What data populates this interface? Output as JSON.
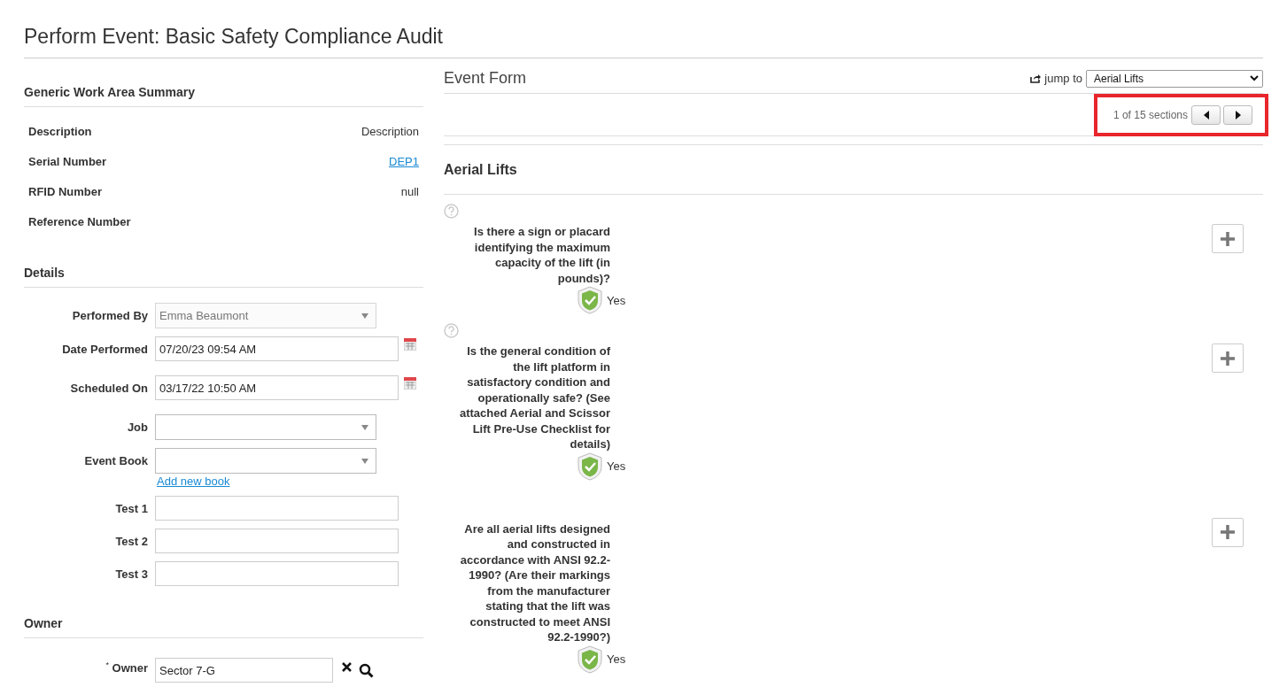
{
  "page_title": "Perform Event: Basic Safety Compliance Audit",
  "summary": {
    "title": "Generic Work Area Summary",
    "rows": [
      {
        "label": "Description",
        "value": "Description"
      },
      {
        "label": "Serial Number",
        "link": "DEP1"
      },
      {
        "label": "RFID Number",
        "value": "null"
      },
      {
        "label": "Reference Number"
      }
    ]
  },
  "details": {
    "title": "Details",
    "fields": [
      {
        "label": "Performed By",
        "kind": "select",
        "value": "Emma Beaumont",
        "disabled": true
      },
      {
        "label": "Date Performed",
        "kind": "date",
        "value": "07/20/23 09:54 AM",
        "disabled": false
      },
      {
        "label": "Scheduled On",
        "kind": "date",
        "value": "03/17/22 10:50 AM",
        "disabled": false
      },
      {
        "label": "Job",
        "kind": "select",
        "disabled": false
      },
      {
        "label": "Event Book",
        "kind": "select",
        "disabled": false,
        "link": "Add new book"
      },
      {
        "label": "Test 1",
        "kind": "text",
        "disabled": false
      },
      {
        "label": "Test 2",
        "kind": "text",
        "disabled": false
      },
      {
        "label": "Test 3",
        "kind": "text",
        "disabled": false
      }
    ]
  },
  "owner": {
    "title": "Owner",
    "required_mark": "*",
    "label": "Owner",
    "value": "Sector 7-G"
  },
  "event_form": {
    "title": "Event Form",
    "jump_label": "jump to",
    "jump_value": "Aerial Lifts",
    "pager": "1 of 15 sections",
    "highlighted": true,
    "section_title": "Aerial Lifts",
    "questions": [
      {
        "help_icon": true,
        "text": "Is there a sign or placard identifying the maximum capacity of the lift (in pounds)?",
        "answer": "Yes"
      },
      {
        "help_icon": true,
        "text": "Is the general condition of the lift platform in satisfactory condition and operationally safe? (See attached Aerial and Scissor Lift Pre-Use Checklist for details)",
        "answer": "Yes"
      },
      {
        "help_icon": false,
        "text": "Are all aerial lifts designed and constructed in accordance with ANSI 92.2-1990? (Are their markings from the manufacturer stating that the lift was constructed to meet ANSI 92.2-1990?)",
        "answer": "Yes"
      }
    ]
  }
}
